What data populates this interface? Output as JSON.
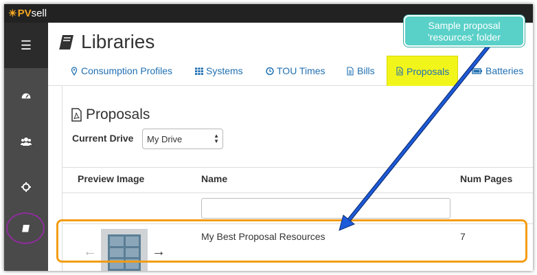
{
  "app": {
    "logo_pv": "PV",
    "logo_sell": "sell"
  },
  "page": {
    "title": "Libraries"
  },
  "tabs": [
    {
      "label": "Consumption Profiles",
      "icon": "map-marker-icon"
    },
    {
      "label": "Systems",
      "icon": "grid-icon"
    },
    {
      "label": "TOU Times",
      "icon": "clock-icon"
    },
    {
      "label": "Bills",
      "icon": "file-icon"
    },
    {
      "label": "Proposals",
      "icon": "pdf-file-icon",
      "active": true
    },
    {
      "label": "Batteries",
      "icon": "battery-icon"
    }
  ],
  "section": {
    "title": "Proposals"
  },
  "drive": {
    "label": "Current Drive",
    "selected": "My Drive"
  },
  "table": {
    "headers": [
      "Preview Image",
      "Name",
      "Num Pages"
    ],
    "rows": [
      {
        "name": "My Best Proposal Resources",
        "num_pages": "7"
      }
    ]
  },
  "callout": {
    "line1": "Sample proposal",
    "line2": "'resources' folder"
  },
  "colors": {
    "highlight_yellow": "#f2f51a",
    "annotation_orange": "#f39c12",
    "annotation_purple": "#8e2d9c",
    "arrow_blue": "#1e5bd8",
    "callout_teal": "#5ad1c8",
    "link_blue": "#1f6fb2"
  }
}
